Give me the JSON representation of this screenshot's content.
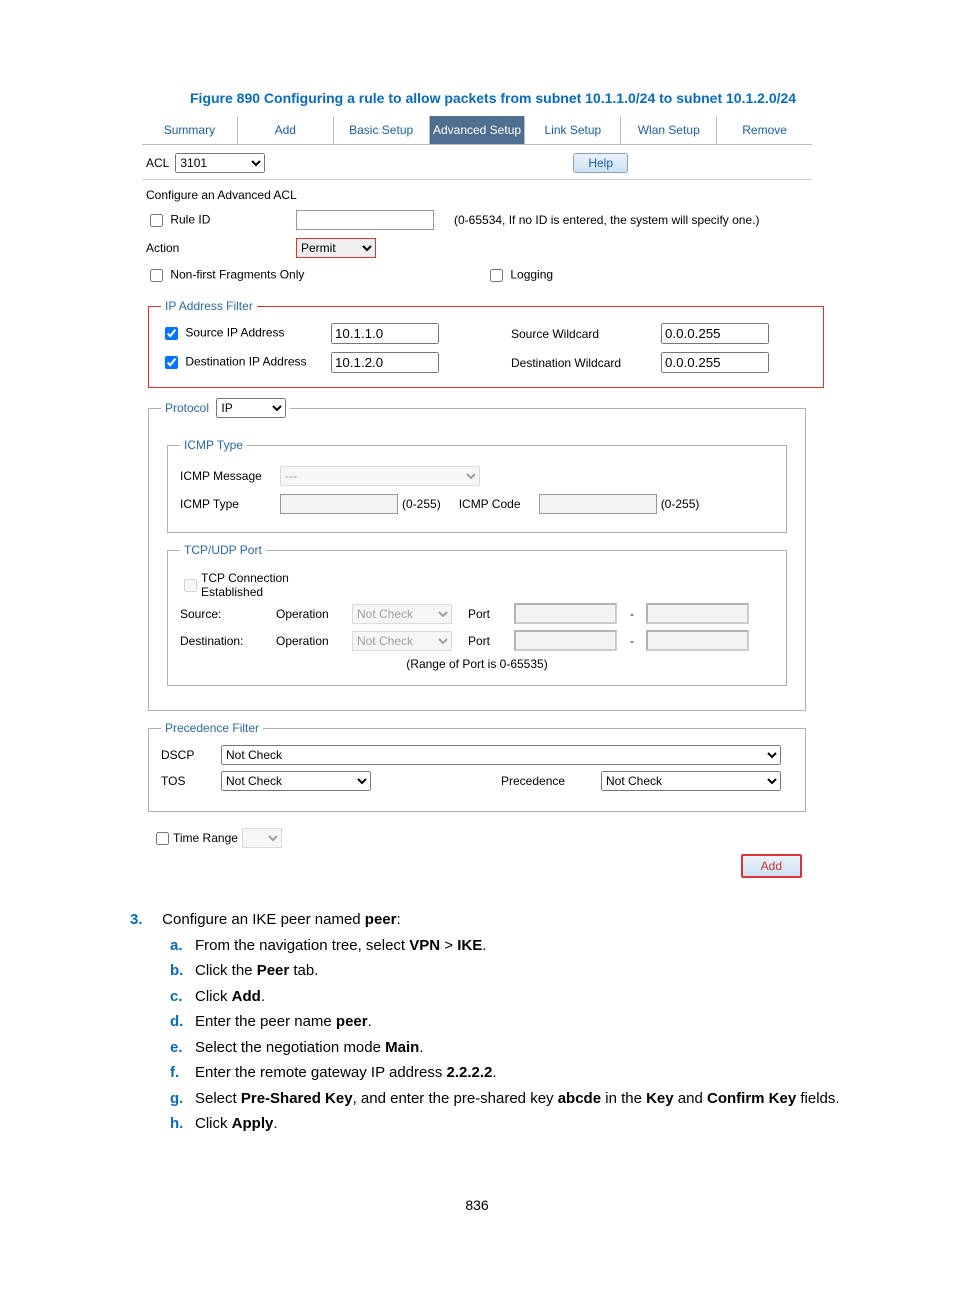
{
  "caption": "Figure 890 Configuring a rule to allow packets from subnet 10.1.1.0/24 to subnet 10.1.2.0/24",
  "tabs": [
    "Summary",
    "Add",
    "Basic Setup",
    "Advanced Setup",
    "Link Setup",
    "Wlan Setup",
    "Remove"
  ],
  "active_tab": 3,
  "acl_label": "ACL",
  "acl_value": "3101",
  "help_btn": "Help",
  "conf_title": "Configure an Advanced ACL",
  "rule_id_label": "Rule ID",
  "rule_id_hint": "(0-65534, If no ID is entered, the system will specify one.)",
  "action_label": "Action",
  "action_value": "Permit",
  "nonfirst_label": "Non-first Fragments Only",
  "logging_label": "Logging",
  "ip_filter": {
    "legend": "IP Address Filter",
    "src_label": "Source IP Address",
    "src_ip": "10.1.1.0",
    "src_w_label": "Source Wildcard",
    "src_w": "0.0.0.255",
    "dst_label": "Destination IP Address",
    "dst_ip": "10.1.2.0",
    "dst_w_label": "Destination Wildcard",
    "dst_w": "0.0.0.255"
  },
  "protocol_legend": "Protocol",
  "protocol_value": "IP",
  "icmp": {
    "legend": "ICMP Type",
    "msg_label": "ICMP Message",
    "msg_value": "---",
    "type_label": "ICMP Type",
    "type_hint": "(0-255)",
    "code_label": "ICMP Code",
    "code_hint": "(0-255)"
  },
  "tcpudp": {
    "legend": "TCP/UDP Port",
    "tcp_est_label": "TCP Connection Established",
    "src_label": "Source:",
    "dst_label": "Destination:",
    "op_label": "Operation",
    "op_value": "Not Check",
    "port_label": "Port",
    "dash": "-",
    "range_hint": "(Range of Port is 0-65535)"
  },
  "prec": {
    "legend": "Precedence Filter",
    "dscp_label": "DSCP",
    "dscp_value": "Not Check",
    "tos_label": "TOS",
    "tos_value": "Not Check",
    "prec_label": "Precedence",
    "prec_value": "Not Check"
  },
  "timerange_label": "Time Range",
  "add_btn": "Add",
  "step_num": "3.",
  "step_text_a": "Configure an IKE peer named ",
  "step_text_b": "peer",
  "step_text_c": ":",
  "subs": [
    {
      "l": "a.",
      "pre": "From the navigation tree, select ",
      "b1": "VPN",
      "mid": " > ",
      "b2": "IKE",
      "post": "."
    },
    {
      "l": "b.",
      "pre": "Click the ",
      "b1": "Peer",
      "post": " tab."
    },
    {
      "l": "c.",
      "pre": "Click ",
      "b1": "Add",
      "post": "."
    },
    {
      "l": "d.",
      "pre": "Enter the peer name ",
      "b1": "peer",
      "post": "."
    },
    {
      "l": "e.",
      "pre": "Select the negotiation mode ",
      "b1": "Main",
      "post": "."
    },
    {
      "l": "f.",
      "pre": "Enter the remote gateway IP address ",
      "b1": "2.2.2.2",
      "post": "."
    },
    {
      "l": "g.",
      "pre": "Select ",
      "b1": "Pre-Shared Key",
      "mid": ", and enter the pre-shared key ",
      "b2": "abcde",
      "mid2": " in the ",
      "b3": "Key",
      "mid3": " and ",
      "b4": "Confirm Key",
      "post": " fields."
    },
    {
      "l": "h.",
      "pre": "Click ",
      "b1": "Apply",
      "post": "."
    }
  ],
  "pagenum": "836"
}
